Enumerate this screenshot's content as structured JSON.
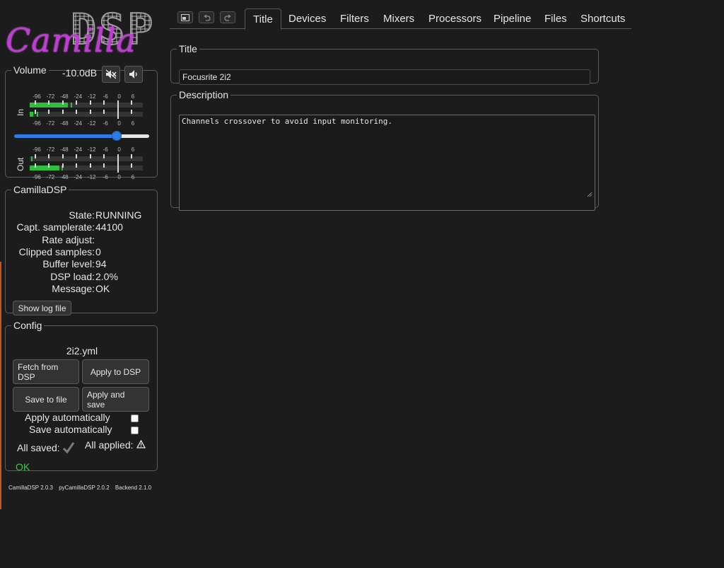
{
  "logo": {
    "dsp_text": [
      "D",
      "S",
      "P"
    ],
    "camilla_text": "Camilla"
  },
  "volume": {
    "legend": "Volume",
    "level": "-10.0dB",
    "slider_fraction": 0.78,
    "mute_icon": "speaker-muted-icon",
    "speaker_icon": "speaker-icon",
    "in_label": "In",
    "out_label": "Out",
    "scale": [
      "-96",
      "-72",
      "-48",
      "-24",
      "-12",
      "-6",
      "0",
      "6"
    ],
    "in_meters": [
      {
        "level_fraction": 0.34,
        "peak_fraction": 0.36
      },
      {
        "level_fraction": 0.03,
        "peak_fraction": 0.06
      }
    ],
    "out_meters": [
      {
        "level_fraction": 0.0,
        "peak_fraction": 0.01
      },
      {
        "level_fraction": 0.26,
        "peak_fraction": 0.28
      }
    ],
    "meter_color": "#2fbf3c"
  },
  "status": {
    "legend": "CamillaDSP",
    "rows": [
      {
        "key": "State:",
        "value": "RUNNING"
      },
      {
        "key": "Capt. samplerate:",
        "value": "44100"
      },
      {
        "key": "Rate adjust:",
        "value": ""
      },
      {
        "key": "Clipped samples:",
        "value": "0"
      },
      {
        "key": "Buffer level:",
        "value": "94"
      },
      {
        "key": "DSP load:",
        "value": "2.0%"
      },
      {
        "key": "Message:",
        "value": "OK"
      }
    ],
    "log_button": "Show log file"
  },
  "config": {
    "legend": "Config",
    "filename": "2i2.yml",
    "fetch_button": "Fetch from DSP",
    "apply_button": "Apply to DSP",
    "save_button": "Save to file",
    "apply_save_button": "Apply and save",
    "apply_auto_label": "Apply automatically",
    "save_auto_label": "Save automatically",
    "all_saved_label": "All saved:",
    "all_applied_label": "All applied:",
    "saved_icon": "checkmark-icon",
    "applied_icon": "warning-icon",
    "ok_text": "OK"
  },
  "versions": [
    "CamillaDSP 2.0.3",
    "pyCamillaDSP 2.0.2",
    "Backend 2.1.0"
  ],
  "toolbar": {
    "icons": [
      "compact-view-icon",
      "undo-icon",
      "redo-icon"
    ]
  },
  "tabs": [
    "Title",
    "Devices",
    "Filters",
    "Mixers",
    "Processors",
    "Pipeline",
    "Files",
    "Shortcuts"
  ],
  "active_tab": "Title",
  "title_section": {
    "legend": "Title",
    "value": "Focusrite 2i2"
  },
  "description_section": {
    "legend": "Description",
    "value": "Channels crossover to avoid input monitoring."
  }
}
